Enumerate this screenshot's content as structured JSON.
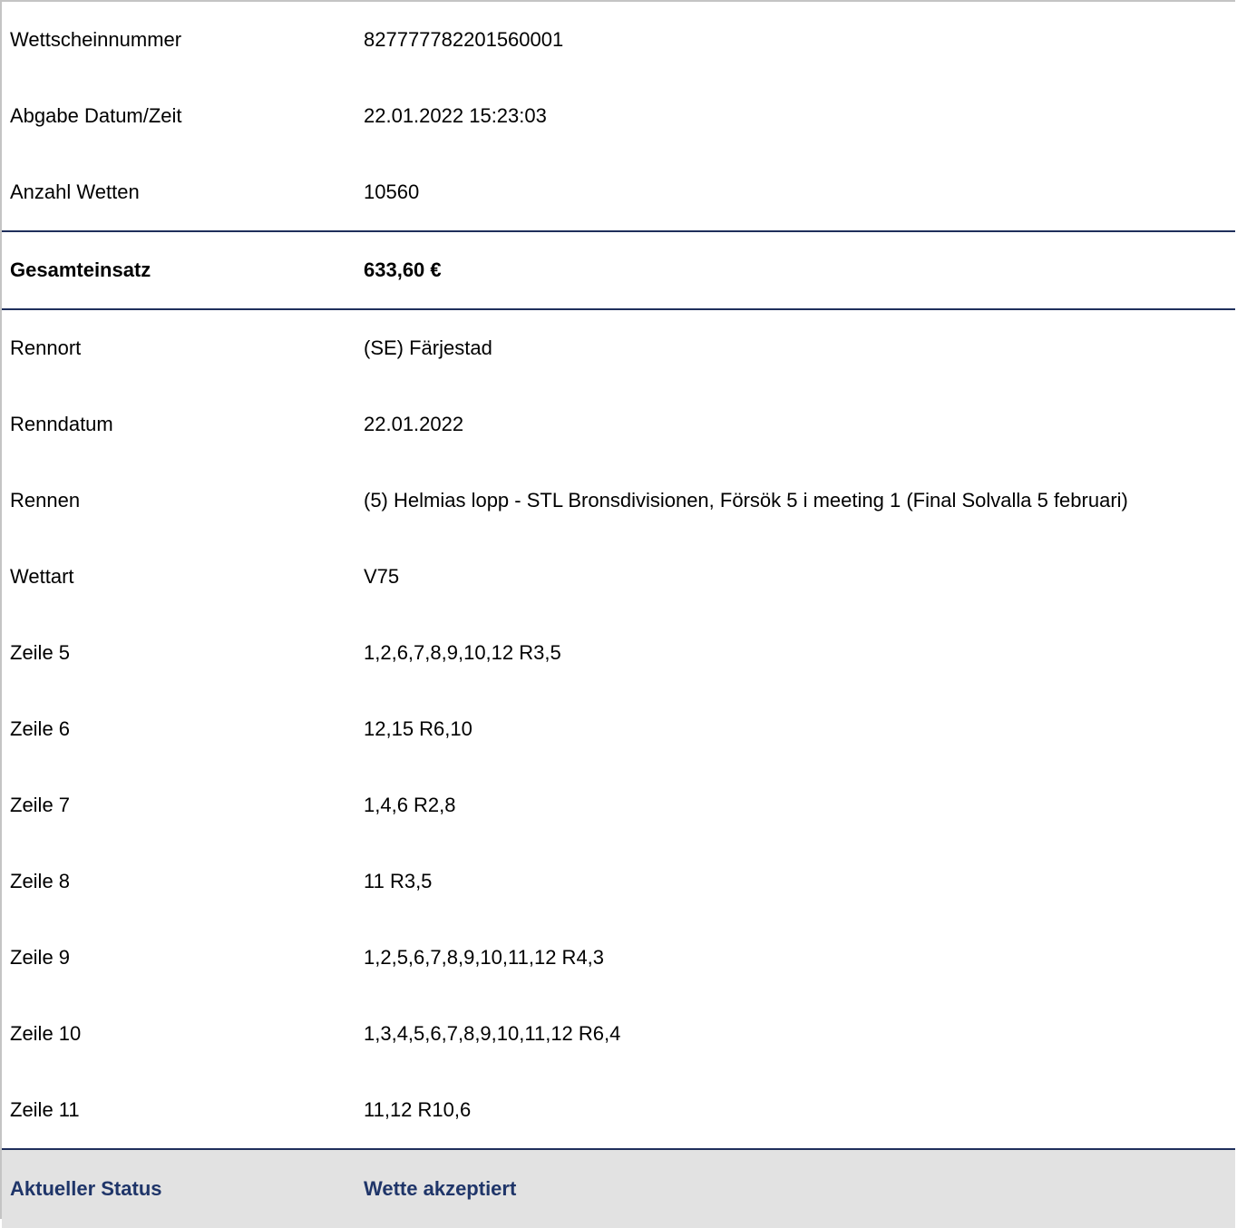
{
  "ticket": {
    "rows_top": [
      {
        "label": "Wettscheinnummer",
        "value": "827777782201560001"
      },
      {
        "label": "Abgabe Datum/Zeit",
        "value": "22.01.2022 15:23:03"
      },
      {
        "label": "Anzahl Wetten",
        "value": "10560"
      }
    ],
    "total": {
      "label": "Gesamteinsatz",
      "value": "633,60 €"
    },
    "rows_details": [
      {
        "label": "Rennort",
        "value": "(SE) Färjestad"
      },
      {
        "label": "Renndatum",
        "value": "22.01.2022"
      },
      {
        "label": "Rennen",
        "value": "(5) Helmias lopp - STL Bronsdivisionen, Försök 5 i meeting 1 (Final Solvalla 5 februari)"
      },
      {
        "label": "Wettart",
        "value": "V75"
      },
      {
        "label": "Zeile 5",
        "value": "1,2,6,7,8,9,10,12 R3,5"
      },
      {
        "label": "Zeile 6",
        "value": "12,15 R6,10"
      },
      {
        "label": "Zeile 7",
        "value": "1,4,6 R2,8"
      },
      {
        "label": "Zeile 8",
        "value": "11 R3,5"
      },
      {
        "label": "Zeile 9",
        "value": "1,2,5,6,7,8,9,10,11,12 R4,3"
      },
      {
        "label": "Zeile 10",
        "value": "1,3,4,5,6,7,8,9,10,11,12 R6,4"
      },
      {
        "label": "Zeile 11",
        "value": "11,12 R10,6"
      }
    ],
    "status": {
      "label": "Aktueller Status",
      "value": "Wette akzeptiert"
    }
  },
  "colors": {
    "divider": "#1f2f5c",
    "status_text": "#1f3569",
    "status_background": "#e2e2e2"
  }
}
